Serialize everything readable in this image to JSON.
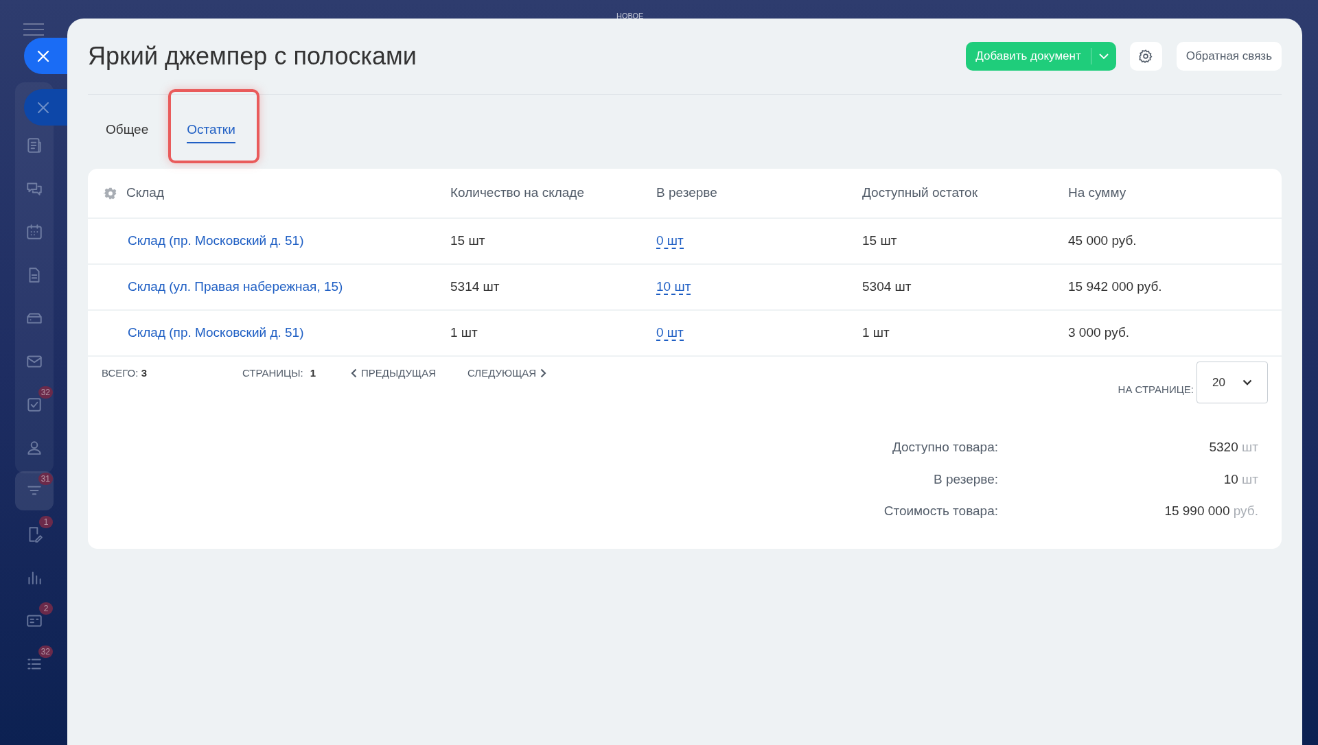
{
  "top_label": "НОВОЕ",
  "sidebar": {
    "items": [
      {
        "kind": "news",
        "selected": false
      },
      {
        "kind": "chat",
        "selected": false
      },
      {
        "kind": "calendar",
        "selected": false
      },
      {
        "kind": "document",
        "selected": false
      },
      {
        "kind": "drive",
        "selected": false
      },
      {
        "kind": "mail",
        "selected": false
      },
      {
        "kind": "tasks",
        "badge": "32",
        "selected": false
      },
      {
        "kind": "contacts",
        "selected": false
      },
      {
        "kind": "funnel",
        "badge": "31",
        "selected": true
      },
      {
        "kind": "edit",
        "badge": "1",
        "selected": false
      },
      {
        "kind": "chart",
        "selected": false
      },
      {
        "kind": "card",
        "badge": "2",
        "selected": false
      },
      {
        "kind": "list",
        "badge": "32",
        "selected": false
      }
    ]
  },
  "window": {
    "title": "Яркий джемпер с полосками"
  },
  "header_buttons": {
    "add": "Добавить документ",
    "feedback": "Обратная связь"
  },
  "tabs": [
    {
      "label": "Общее",
      "selected": false,
      "highlighted": false
    },
    {
      "label": "Остатки",
      "selected": true,
      "highlighted": true
    }
  ],
  "table": {
    "columns": [
      "Склад",
      "Количество на складе",
      "В резерве",
      "Доступный остаток",
      "На сумму"
    ],
    "rows": [
      {
        "warehouse": "Склад (пр. Московский д. 51)",
        "quantity": "15 шт",
        "reserved": "0 шт",
        "available": "15 шт",
        "amount": "45 000 руб."
      },
      {
        "warehouse": "Склад (ул. Правая набережная, 15)",
        "quantity": "5314 шт",
        "reserved": "10 шт",
        "available": "5304 шт",
        "amount": "15 942 000 руб."
      },
      {
        "warehouse": "Склад (пр. Московский д. 51)",
        "quantity": "1 шт",
        "reserved": "0 шт",
        "available": "1 шт",
        "amount": "3 000 руб."
      }
    ]
  },
  "pagination": {
    "total_label": "ВСЕГО:",
    "total": "3",
    "pages_label": "СТРАНИЦЫ:",
    "page": "1",
    "prev": "ПРЕДЫДУЩАЯ",
    "next": "СЛЕДУЮЩАЯ",
    "per_page_label": "НА СТРАНИЦЕ:",
    "per_page": "20"
  },
  "summary": [
    {
      "label": "Доступно товара:",
      "value": "5320",
      "unit": "шт"
    },
    {
      "label": "В резерве:",
      "value": "10",
      "unit": "шт"
    },
    {
      "label": "Стоимость товара:",
      "value": "15 990 000",
      "unit": "руб."
    }
  ]
}
